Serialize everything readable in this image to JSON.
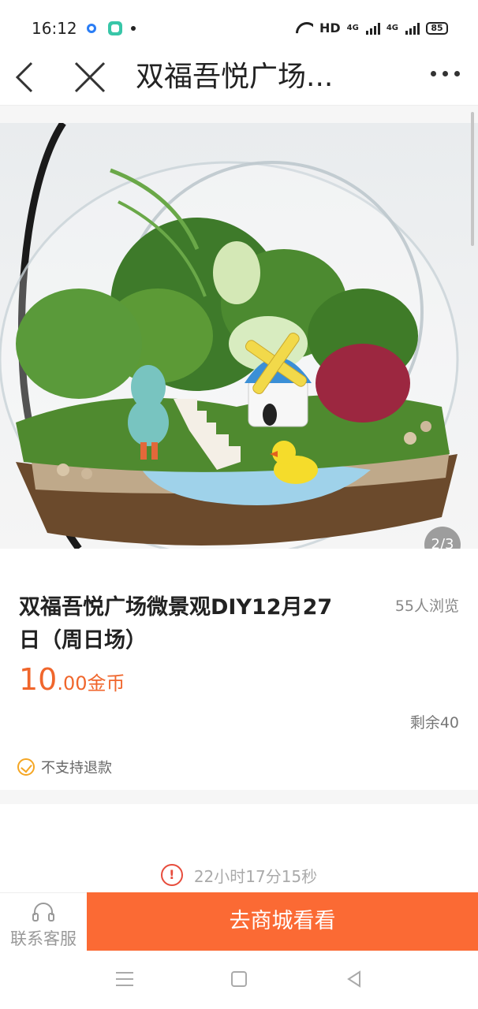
{
  "status_bar": {
    "time": "16:12",
    "hd_label": "HD",
    "net1": "4G",
    "net2": "4G",
    "battery": "85"
  },
  "nav": {
    "title": "双福吾悦广场...",
    "back_icon": "chevron-left-icon",
    "close_icon": "close-icon",
    "more_icon": "more-dots-icon"
  },
  "gallery": {
    "page_indicator": "2/3"
  },
  "product": {
    "title": "双福吾悦广场微景观DIY12月27日（周日场）",
    "views": "55人浏览",
    "price_int": "10",
    "price_dec": ".00",
    "price_unit": "金币",
    "stock": "剩余40",
    "refund_policy": "不支持退款"
  },
  "countdown": {
    "text": "22小时17分15秒"
  },
  "actions": {
    "service_label": "联系客服",
    "go_mall_label": "去商城看看"
  },
  "colors": {
    "accent": "#fb6a34",
    "price": "#f0662c",
    "warning": "#f5a623",
    "alert": "#e74c3c"
  }
}
